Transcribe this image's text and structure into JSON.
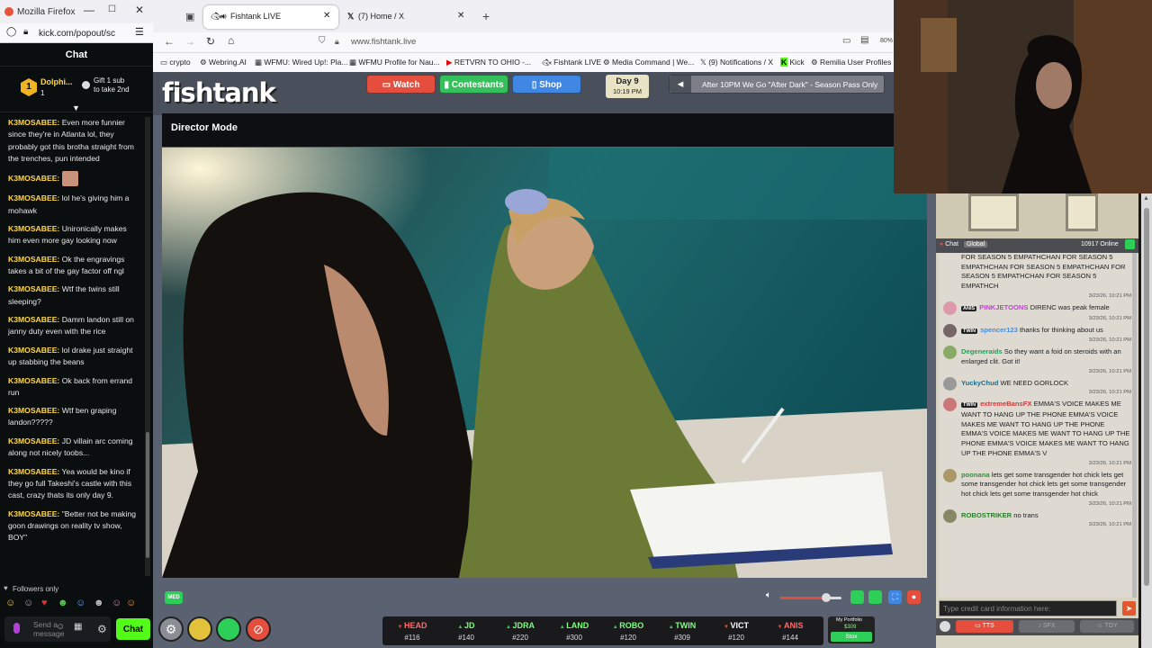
{
  "kick_window": {
    "title": "Mozilla Firefox",
    "url": "kick.com/popout/sc",
    "chat_label": "Chat",
    "pinned_user": "Dolphi...",
    "pinned_count": "1",
    "gift_text": "Gift 1 sub to take 2nd",
    "messages": [
      {
        "user": "K3MOSABEE:",
        "text": "Even more funnier since they're in Atlanta lol, they probably got this brotha straight from the trenches, pun intended"
      },
      {
        "user": "K3MOSABEE:",
        "text": ""
      },
      {
        "user": "K3MOSABEE:",
        "text": "lol he's giving him a mohawk"
      },
      {
        "user": "K3MOSABEE:",
        "text": "Unironically makes him even more gay looking now"
      },
      {
        "user": "K3MOSABEE:",
        "text": "Ok the engravings takes a bit of the gay factor off ngl"
      },
      {
        "user": "K3MOSABEE:",
        "text": "Wtf the twins still sleeping?"
      },
      {
        "user": "K3MOSABEE:",
        "text": "Damm landon still on janny duty even with the rice"
      },
      {
        "user": "K3MOSABEE:",
        "text": "lol drake just straight up stabbing the beans"
      },
      {
        "user": "K3MOSABEE:",
        "text": "Ok back from errand run"
      },
      {
        "user": "K3MOSABEE:",
        "text": "Wtf ben graping landon?????"
      },
      {
        "user": "K3MOSABEE:",
        "text": "JD villain arc coming along not nicely toobs..."
      },
      {
        "user": "K3MOSABEE:",
        "text": "Yea would be kino if they go full Takeshi's castle with this cast, crazy thats its only day 9."
      },
      {
        "user": "K3MOSABEE:",
        "text": "\"Better not be making goon drawings on reality tv show, BOY\""
      }
    ],
    "followers_only": "Followers only",
    "send_placeholder": "Send a message",
    "chat_button": "Chat"
  },
  "browser": {
    "tabs": [
      {
        "label": "Fishtank LIVE",
        "active": true
      },
      {
        "label": "(7) Home / X",
        "active": false
      }
    ],
    "url": "www.fishtank.live",
    "bookmarks": [
      "crypto",
      "Webring.AI",
      "WFMU: Wired Up!: Pla...",
      "WFMU Profile for Nau...",
      "RETVRN TO OHIO -...",
      "Fishtank LIVE",
      "Media Command | We...",
      "(9) Notifications / X",
      "Kick",
      "Remilia User Profiles"
    ]
  },
  "site": {
    "logo": "fishtank",
    "nav": {
      "watch": "Watch",
      "contestants": "Contestants",
      "shop": "Shop"
    },
    "day": "Day 9",
    "time": "10:19 PM",
    "ticker": "After 10PM We Go \"After Dark\" - Season Pass Only",
    "mode_title": "Director Mode",
    "quality_badge": "MED",
    "volume": 0.75,
    "contestants": [
      {
        "name": "HEAD",
        "rank": "#116",
        "trend": "down",
        "color": "#ff6a6a"
      },
      {
        "name": "JD",
        "rank": "#140",
        "trend": "up",
        "color": "#7dff7d"
      },
      {
        "name": "JDRA",
        "rank": "#220",
        "trend": "up",
        "color": "#7dff7d"
      },
      {
        "name": "LAND",
        "rank": "#300",
        "trend": "up",
        "color": "#7dff7d"
      },
      {
        "name": "ROBO",
        "rank": "#120",
        "trend": "up",
        "color": "#7dff7d"
      },
      {
        "name": "TWIN",
        "rank": "#309",
        "trend": "up",
        "color": "#7dff7d"
      },
      {
        "name": "VICT",
        "rank": "#120",
        "trend": "down",
        "color": "#ffffff"
      },
      {
        "name": "ANIS",
        "rank": "#144",
        "trend": "down",
        "color": "#ff6a6a"
      }
    ],
    "portfolio_label": "My Portfolio",
    "portfolio_value": "$309",
    "portfolio_button": "Stox"
  },
  "fish_chat": {
    "tab_chat": "Chat",
    "tab_global": "Global",
    "online": "10917 Online",
    "messages": [
      {
        "badge": "",
        "user": "",
        "user_color": "#222",
        "text": "FOR SEASON 5 EMPATHCHAN FOR SEASON 5 EMPATHCHAN FOR SEASON 5 EMPATHCHAN FOR SEASON 5 EMPATHCHAN FOR SEASON 5 EMPATHCH",
        "time": "3/23/26, 10:21 PM"
      },
      {
        "badge": "ANIS",
        "user": "PINKJETOONS",
        "user_color": "#c23ee0",
        "text": "DIRENC was peak female",
        "time": "3/23/26, 10:21 PM"
      },
      {
        "badge": "TWIN",
        "user": "spencer123",
        "user_color": "#4a8dd6",
        "text": "thanks for thinking about us",
        "time": "3/23/26, 10:21 PM"
      },
      {
        "badge": "",
        "user": "Degeneraids",
        "user_color": "#2f9a5b",
        "text": "So they want a foid on steroids with an enlarged clit. Got it!",
        "time": "3/23/26, 10:21 PM"
      },
      {
        "badge": "",
        "user": "YuckyChud",
        "user_color": "#1c6e8a",
        "text": "WE NEED GORLOCK",
        "time": "3/23/26, 10:21 PM"
      },
      {
        "badge": "TWIN",
        "user": "extremeBansFX",
        "user_color": "#d43a3a",
        "text": "EMMA'S VOICE MAKES ME WANT TO HANG UP THE PHONE EMMA'S VOICE MAKES ME WANT TO HANG UP THE PHONE EMMA'S VOICE MAKES ME WANT TO HANG UP THE PHONE EMMA'S VOICE MAKES ME WANT TO HANG UP THE PHONE EMMA'S V",
        "time": "3/23/26, 10:21 PM"
      },
      {
        "badge": "",
        "user": "poonana",
        "user_color": "#3a8a3a",
        "text": "lets get some transgender hot chick lets get some transgender hot chick lets get some transgender hot chick lets get some transgender hot chick",
        "time": "3/23/26, 10:21 PM"
      },
      {
        "badge": "",
        "user": "ROBOSTRIKER",
        "user_color": "#2a7d2a",
        "text": "no trans",
        "time": "3/23/26, 10:21 PM"
      }
    ],
    "input_placeholder": "Type credit card information here:",
    "footer": {
      "tts": "TTS",
      "sfx": "SFX",
      "toy": "TOY"
    }
  }
}
